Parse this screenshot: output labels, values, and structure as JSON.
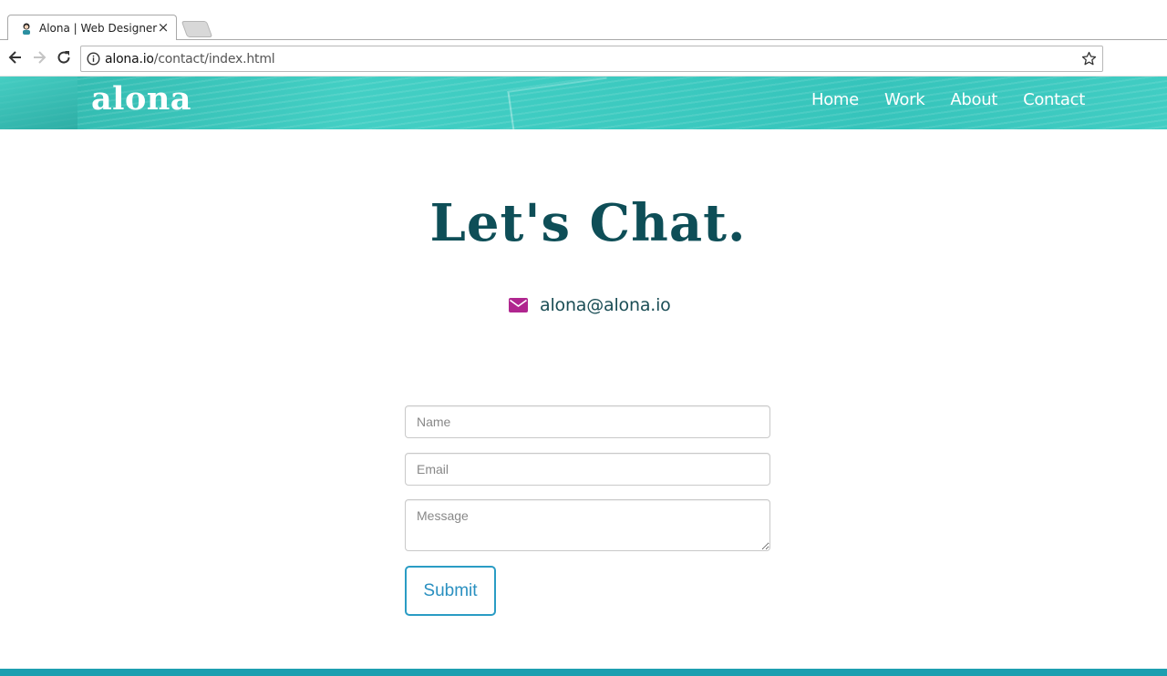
{
  "browser": {
    "tab_title": "Alona | Web Designer",
    "tab_close": "×",
    "url_host": "alona.io",
    "url_path": "/contact/index.html"
  },
  "site": {
    "logo": "alona",
    "nav": [
      "Home",
      "Work",
      "About",
      "Contact"
    ],
    "accent_color": "#3ccac0"
  },
  "main": {
    "heading": "Let's Chat.",
    "email": "alona@alona.io",
    "email_icon": "envelope-icon",
    "email_icon_color": "#b0268f"
  },
  "form": {
    "name_placeholder": "Name",
    "email_placeholder": "Email",
    "message_placeholder": "Message",
    "submit_label": "Submit",
    "button_color": "#2a9cc4"
  }
}
